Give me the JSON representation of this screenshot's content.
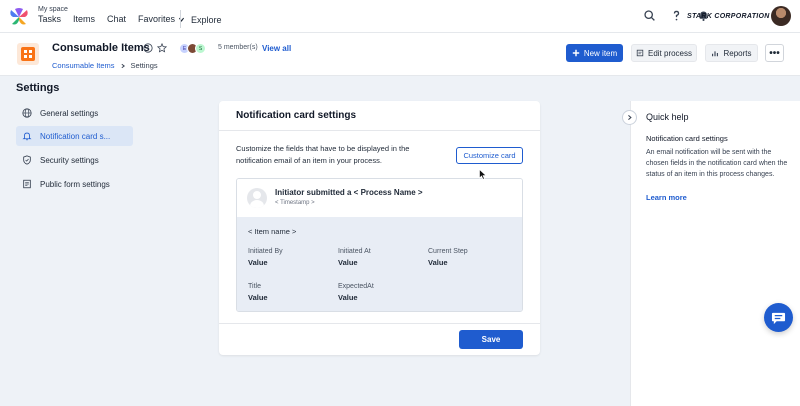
{
  "topnav": {
    "my_space": "My space",
    "links": [
      "Tasks",
      "Items",
      "Chat",
      "Favorites"
    ],
    "explore": "Explore",
    "company": "STARK CORPORATION"
  },
  "process": {
    "title": "Consumable Items",
    "member_count": "5 member(s)",
    "view_all": "View all",
    "breadcrumb": {
      "parent": "Consumable Items",
      "current": "Settings"
    },
    "buttons": {
      "new_item": "New item",
      "edit_process": "Edit process",
      "reports": "Reports",
      "more": "•••"
    }
  },
  "sidebar": {
    "title": "Settings",
    "items": [
      {
        "label": "General settings"
      },
      {
        "label": "Notification card s..."
      },
      {
        "label": "Security settings"
      },
      {
        "label": "Public form settings"
      }
    ]
  },
  "card": {
    "title": "Notification card settings",
    "description": "Customize the fields that have to be displayed in the notification email of an item in your process.",
    "customize_button": "Customize card",
    "preview": {
      "title": "Initiator submitted a < Process Name >",
      "timestamp": "< Timestamp >",
      "item_name": "< Item name >",
      "fields": [
        {
          "label": "Initiated By",
          "value": "Value"
        },
        {
          "label": "Initiated At",
          "value": "Value"
        },
        {
          "label": "Current Step",
          "value": "Value"
        },
        {
          "label": "Title",
          "value": "Value"
        },
        {
          "label": "ExpectedAt",
          "value": "Value"
        }
      ]
    },
    "save_button": "Save"
  },
  "help": {
    "title": "Quick help",
    "subtitle": "Notification card settings",
    "body": "An email notification will be sent with the chosen fields in the notification card when the status of an item in this process changes.",
    "link": "Learn more"
  },
  "members": [
    "E",
    "",
    "S"
  ],
  "colors": {
    "accent": "#1f5ccf",
    "process_icon": "#f97316",
    "active_bg": "#dbe6f6"
  }
}
